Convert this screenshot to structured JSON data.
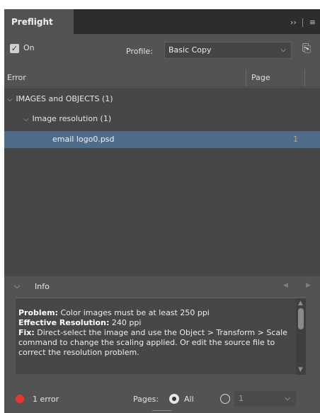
{
  "panel": {
    "tab_title": "Preflight",
    "tab_tools": {
      "expand": "››",
      "menu": "≡"
    }
  },
  "top": {
    "on_label": "On",
    "checkbox_mark": "✓",
    "profile_label": "Profile:",
    "profile_value": "Basic Copy",
    "profile_chevron": "⌵",
    "profile_icon": "⎘"
  },
  "columns": {
    "error": "Error",
    "page": "Page"
  },
  "errors_list": [
    {
      "chev": "⌵",
      "label": "IMAGES and OBJECTS (1)",
      "page": ""
    },
    {
      "chev": "⌵",
      "label": "Image resolution (1)",
      "page": ""
    },
    {
      "chev": "",
      "label": "email logo0.psd",
      "page": "1"
    }
  ],
  "info": {
    "chevron": "⌵",
    "label": "Info",
    "prev": "◀",
    "next": "▶",
    "problem_label": "Problem:",
    "problem_text": "Color images must be at least 250 ppi",
    "effective_label": "Effective Resolution:",
    "effective_text": "240 ppi",
    "fix_label": "Fix:",
    "fix_text": "Direct-select the image and use the Object > Transform > Scale command to change the scaling applied. Or edit the source file to correct the resolution problem.",
    "scroll_up": "▲",
    "scroll_down": "▼"
  },
  "status": {
    "error_count": "1 error",
    "pages_label": "Pages:",
    "all_label": "All",
    "range_value": "1",
    "range_chevron": "⌵"
  },
  "colors": {
    "error_red": "#e8372f",
    "page_orange": "#e79b3c",
    "selection": "#4f6d89"
  }
}
